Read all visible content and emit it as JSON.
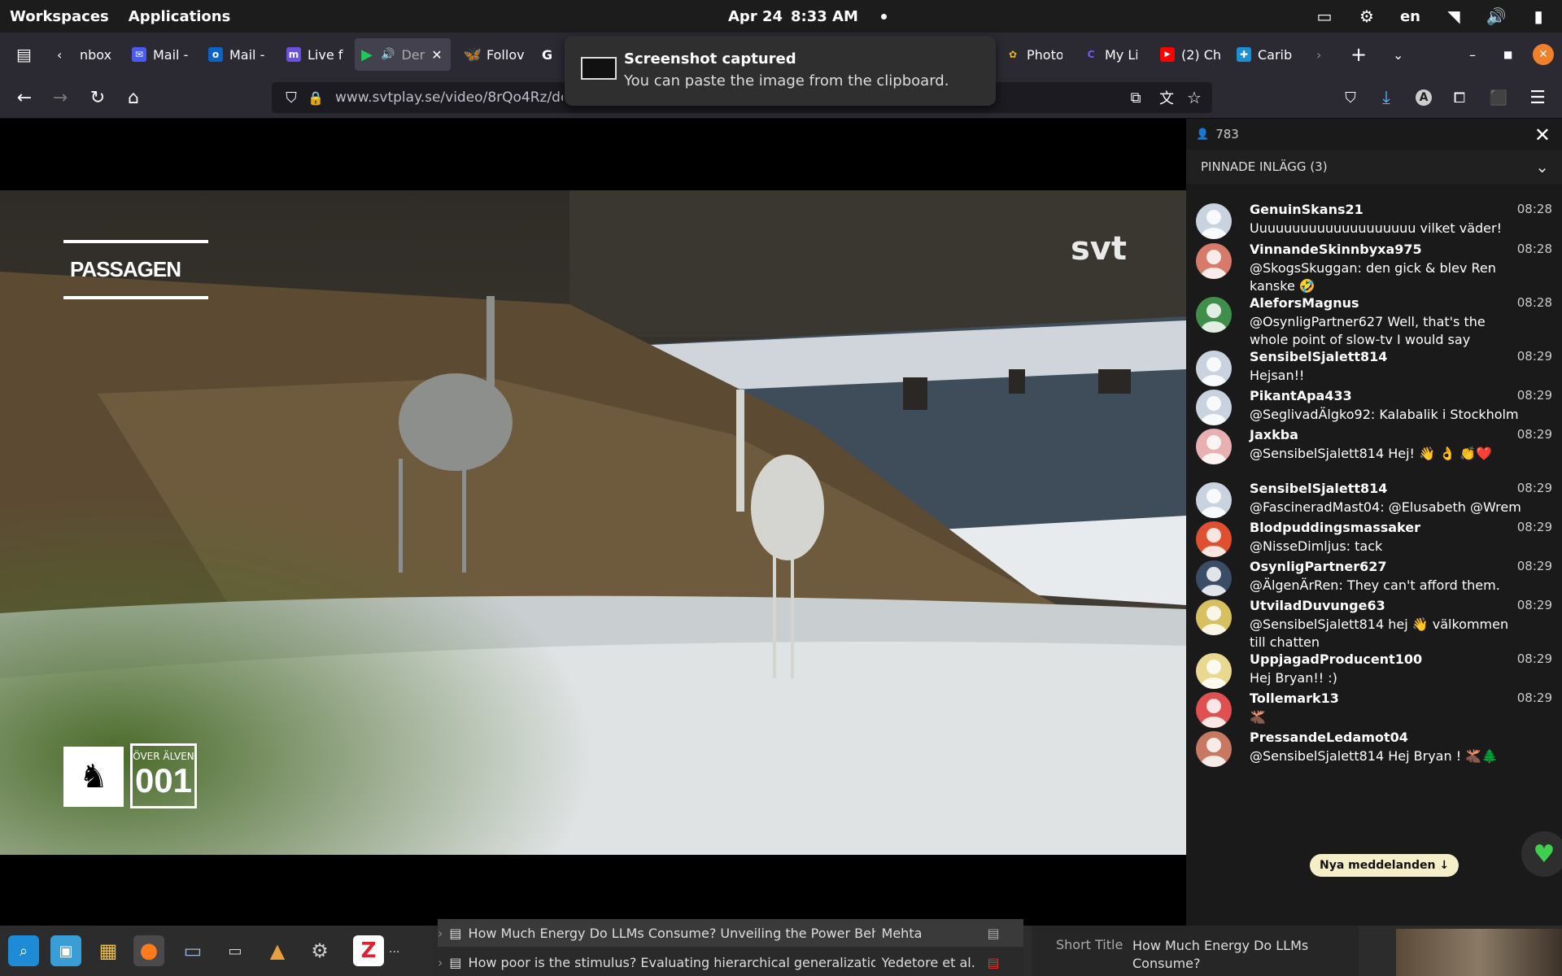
{
  "topbar": {
    "workspaces": "Workspaces",
    "applications": "Applications",
    "date": "Apr 24",
    "time": "8:33 AM",
    "lang": "en"
  },
  "tabs": [
    {
      "label": "nbox",
      "icon": "inbox-icon"
    },
    {
      "label": "Mail -",
      "icon": "mail-icon"
    },
    {
      "label": "Mail -",
      "icon": "outlook-icon"
    },
    {
      "label": "Live f",
      "icon": "mastodon-icon"
    },
    {
      "label": "Der",
      "icon": "play-icon"
    },
    {
      "label": "Follov",
      "icon": "bluesky-icon"
    },
    {
      "label": "G",
      "icon": "g-icon"
    },
    {
      "label": "Photo",
      "icon": "photos-icon"
    },
    {
      "label": "My Li",
      "icon": "c-icon"
    },
    {
      "label": "(2) Ch",
      "icon": "youtube-icon"
    },
    {
      "label": "Carib",
      "icon": "carib-icon"
    }
  ],
  "url": "www.svtplay.se/video/8rQo4Rz/den",
  "notification": {
    "title": "Screenshot captured",
    "body": "You can paste the image from the clipboard."
  },
  "video": {
    "logo": "svt",
    "show_title": "PASSAGEN",
    "badge_top": "ÖVER ÄLVEN",
    "badge_number": "001"
  },
  "chat": {
    "viewer_count": "783",
    "pinned_label": "PINNADE INLÄGG (3)",
    "new_messages_label": "Nya meddelanden ↓",
    "messages": [
      {
        "user": "GenuinSkans21",
        "time": "08:28",
        "text": "Uuuuuuuuuuuuuuuuuuuu vilket väder!"
      },
      {
        "user": "VinnandeSkinnbyxa975",
        "time": "08:28",
        "text": "@SkogsSkuggan: den gick & blev Ren kanske 🤣"
      },
      {
        "user": "AleforsMagnus",
        "time": "08:28",
        "text": "@OsynligPartner627 Well, that's the whole point of slow-tv I would say"
      },
      {
        "user": "SensibelSjalett814",
        "time": "08:29",
        "text": "Hejsan!!"
      },
      {
        "user": "PikantApa433",
        "time": "08:29",
        "text": "@SeglivadÄlgko92: Kalabalik i Stockholm"
      },
      {
        "user": "Jaxkba",
        "time": "08:29",
        "text": "@SensibelSjalett814 Hej! 👋 👌 👏❤️"
      },
      {
        "user": "SensibelSjalett814",
        "time": "08:29",
        "text": "@FascineradMast04: @Elusabeth @Wrem"
      },
      {
        "user": "Blodpuddingsmassaker",
        "time": "08:29",
        "text": "@NisseDimljus: tack"
      },
      {
        "user": "OsynligPartner627",
        "time": "08:29",
        "text": "@ÄlgenÄrRen: They can't afford them."
      },
      {
        "user": "UtviladDuvunge63",
        "time": "08:29",
        "text": "@SensibelSjalett814 hej 👋 välkommen till chatten"
      },
      {
        "user": "UppjagadProducent100",
        "time": "08:29",
        "text": "Hej Bryan!! :)"
      },
      {
        "user": "Tollemark13",
        "time": "08:29",
        "text": "🫎"
      },
      {
        "user": "PressandeLedamot04",
        "time": "",
        "text": "@SensibelSjalett814 Hej Bryan ! 🫎🌲"
      }
    ]
  },
  "taskbar": {
    "more": "...",
    "row1_title": "How Much Energy Do LLMs Consume? Unveiling the Power Behind...",
    "row1_author": "Mehta",
    "row2_title": "How poor is the stimulus? Evaluating hierarchical generalization i...",
    "row2_author": "Yedetore et al.",
    "short_title_label": "Short Title",
    "short_title_value": "How Much Energy Do LLMs Consume?"
  }
}
